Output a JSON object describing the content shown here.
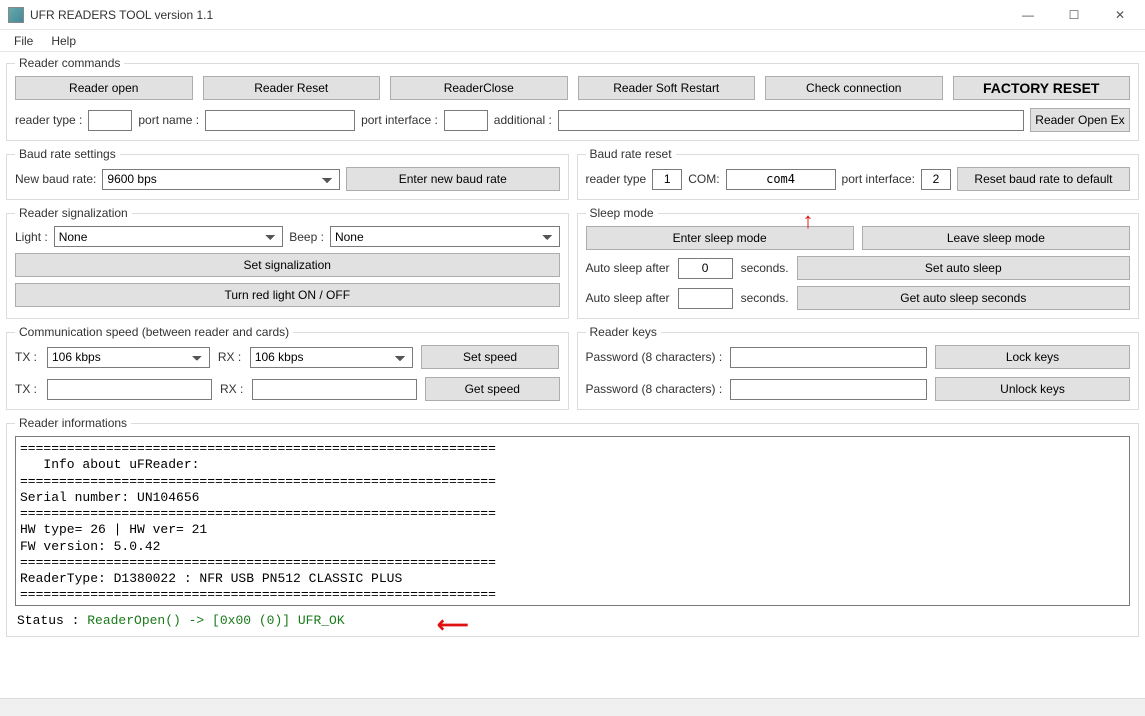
{
  "window": {
    "title": "UFR READERS TOOL version 1.1",
    "min": "—",
    "max": "☐",
    "close": "✕"
  },
  "menu": {
    "file": "File",
    "help": "Help"
  },
  "readerCommands": {
    "legend": "Reader commands",
    "open": "Reader open",
    "reset": "Reader Reset",
    "close": "ReaderClose",
    "softRestart": "Reader Soft Restart",
    "check": "Check connection",
    "factory": "FACTORY RESET",
    "readerTypeLabel": "reader type :",
    "readerType": "",
    "portNameLabel": "port name :",
    "portName": "",
    "portInterfaceLabel": "port interface :",
    "portInterface": "",
    "additionalLabel": "additional :",
    "additional": "",
    "openEx": "Reader Open Ex"
  },
  "baudSettings": {
    "legend": "Baud rate settings",
    "newLabel": "New baud rate:",
    "value": "9600 bps",
    "enter": "Enter new baud rate"
  },
  "baudReset": {
    "legend": "Baud rate reset",
    "readerTypeLabel": "reader type",
    "readerType": "1",
    "comLabel": "COM:",
    "com": "com4",
    "portInterfaceLabel": "port interface:",
    "portInterface": "2",
    "reset": "Reset baud rate to default"
  },
  "signal": {
    "legend": "Reader signalization",
    "lightLabel": "Light :",
    "light": "None",
    "beepLabel": "Beep :",
    "beep": "None",
    "setSignal": "Set signalization",
    "redLight": "Turn red light ON / OFF"
  },
  "sleep": {
    "legend": "Sleep mode",
    "enter": "Enter sleep mode",
    "leave": "Leave sleep mode",
    "autoLabel": "Auto sleep after",
    "seconds": "seconds.",
    "val1": "0",
    "val2": "",
    "set": "Set auto sleep",
    "get": "Get auto sleep seconds"
  },
  "comm": {
    "legend": "Communication speed (between reader and cards)",
    "txLabel": "TX :",
    "rxLabel": "RX :",
    "tx": "106 kbps",
    "rx": "106 kbps",
    "txOut": "",
    "rxOut": "",
    "set": "Set speed",
    "get": "Get speed"
  },
  "keys": {
    "legend": "Reader keys",
    "pwLabel": "Password (8 characters) :",
    "pw1": "",
    "pw2": "",
    "lock": "Lock keys",
    "unlock": "Unlock keys"
  },
  "info": {
    "legend": "Reader informations",
    "log": "=============================================================\n   Info about uFReader:\n=============================================================\nSerial number: UN104656\n=============================================================\nHW type= 26 | HW ver= 21\nFW version: 5.0.42\n=============================================================\nReaderType: D1380022 : NFR USB PN512 CLASSIC PLUS\n=============================================================",
    "statusLabel": "Status : ",
    "statusValue": "ReaderOpen() -> [0x00 (0)] UFR_OK"
  }
}
